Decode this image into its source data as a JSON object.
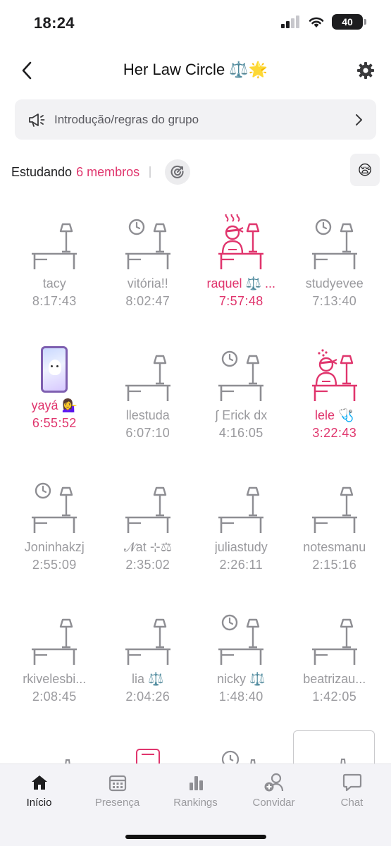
{
  "status": {
    "time": "18:24",
    "battery": "40"
  },
  "header": {
    "title": "Her Law Circle ⚖️🌟"
  },
  "intro": {
    "label": "Introdução/regras do grupo"
  },
  "studying": {
    "label": "Estudando",
    "count": "6 membros",
    "mood_emoji": "😪"
  },
  "members": [
    {
      "name": "tacy",
      "time": "8:17:43",
      "state": "desk",
      "active": false
    },
    {
      "name": "vitória!!",
      "time": "8:02:47",
      "state": "desk-clock",
      "active": false
    },
    {
      "name": "raquel ⚖️ ...",
      "time": "7:57:48",
      "state": "studying-steam",
      "active": true
    },
    {
      "name": "studyevee",
      "time": "7:13:40",
      "state": "desk-clock",
      "active": false
    },
    {
      "name": "yayá 💁‍♀️",
      "time": "6:55:52",
      "state": "phone",
      "active": true
    },
    {
      "name": "llestuda",
      "time": "6:07:10",
      "state": "desk",
      "active": false
    },
    {
      "name": "∫ Erick dx",
      "time": "4:16:05",
      "state": "desk-clock",
      "active": false
    },
    {
      "name": "lele 🩺",
      "time": "3:22:43",
      "state": "studying-sparkle",
      "active": true
    },
    {
      "name": "Joninhakzj",
      "time": "2:55:09",
      "state": "desk-clock",
      "active": false
    },
    {
      "name": "𝓝at ⊹⚖",
      "time": "2:35:02",
      "state": "desk",
      "active": false
    },
    {
      "name": "juliastudy",
      "time": "2:26:11",
      "state": "desk",
      "active": false
    },
    {
      "name": "notesmanu",
      "time": "2:15:16",
      "state": "desk",
      "active": false
    },
    {
      "name": "rkivelesbi...",
      "time": "2:08:45",
      "state": "desk",
      "active": false
    },
    {
      "name": "lia ⚖️",
      "time": "2:04:26",
      "state": "desk",
      "active": false
    },
    {
      "name": "nicky ⚖️",
      "time": "1:48:40",
      "state": "desk-clock",
      "active": false
    },
    {
      "name": "beatrizau...",
      "time": "1:42:05",
      "state": "desk",
      "active": false
    }
  ],
  "tabs": [
    {
      "label": "Início",
      "icon": "home-icon",
      "selected": true
    },
    {
      "label": "Presença",
      "icon": "calendar-icon",
      "selected": false
    },
    {
      "label": "Rankings",
      "icon": "bar-chart-icon",
      "selected": false
    },
    {
      "label": "Convidar",
      "icon": "add-user-icon",
      "selected": false
    },
    {
      "label": "Chat",
      "icon": "chat-icon",
      "selected": false
    }
  ],
  "colors": {
    "accent": "#e0356d",
    "muted": "#9a9a9e",
    "desk_gray": "#8e8e93"
  }
}
